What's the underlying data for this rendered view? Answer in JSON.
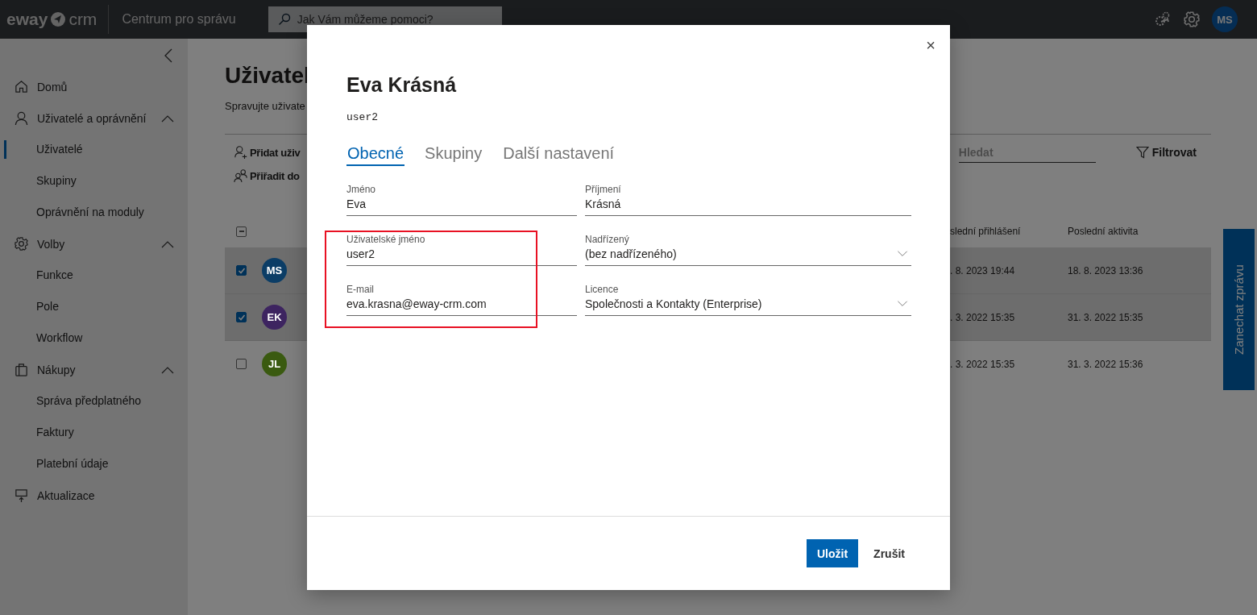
{
  "topbar": {
    "logo_left": "eway",
    "logo_right": "crm",
    "app_title": "Centrum pro správu",
    "search": {
      "placeholder": "Jak Vám můžeme pomoci?"
    },
    "avatar": "MS"
  },
  "sidebar": {
    "items": [
      {
        "label": "Domů",
        "selected": false
      },
      {
        "label": "Uživatelé a oprávnění",
        "selected": false,
        "expanded": true,
        "children": [
          {
            "label": "Uživatelé",
            "selected": true
          },
          {
            "label": "Skupiny",
            "selected": false
          },
          {
            "label": "Oprávnění na moduly",
            "selected": false
          }
        ]
      },
      {
        "label": "Volby",
        "selected": false,
        "expanded": true,
        "children": [
          {
            "label": "Funkce",
            "selected": false
          },
          {
            "label": "Pole",
            "selected": false
          },
          {
            "label": "Workflow",
            "selected": false
          }
        ]
      },
      {
        "label": "Nákupy",
        "selected": false,
        "expanded": true,
        "children": [
          {
            "label": "Správa předplatného",
            "selected": false
          },
          {
            "label": "Faktury",
            "selected": false
          },
          {
            "label": "Platební údaje",
            "selected": false
          }
        ]
      },
      {
        "label": "Aktualizace",
        "selected": false
      }
    ]
  },
  "page": {
    "title": "Uživatel",
    "subtitle": "Spravujte uživate",
    "actions": [
      "Přidat uživ",
      "Přiřadit do"
    ],
    "search": {
      "placeholder": "Hledat"
    },
    "filter": "Filtrovat",
    "table": {
      "header_partial": true,
      "columns": [
        "slední přihlášení",
        "Poslední aktivita"
      ],
      "rows": [
        {
          "checked": true,
          "initials": "MS",
          "color": "#0b3d66",
          "last_login": ". 8. 2023 19:44",
          "last_activity": "18. 8. 2023 13:36"
        },
        {
          "checked": true,
          "initials": "EK",
          "color": "#3d2460",
          "last_login": ". 3. 2022 15:35",
          "last_activity": "31. 3. 2022 15:35"
        },
        {
          "checked": false,
          "initials": "JL",
          "color": "#3a5a10",
          "last_login": ". 3. 2022 15:35",
          "last_activity": "31. 3. 2022 15:36"
        }
      ]
    }
  },
  "feedback": "Zanechat zprávu",
  "dialog": {
    "close": "×",
    "title": "Eva Krásná",
    "subtitle": "user2",
    "tabs": [
      {
        "label": "Obecné",
        "selected": true
      },
      {
        "label": "Skupiny",
        "selected": false
      },
      {
        "label": "Další nastavení",
        "selected": false
      }
    ],
    "fields": [
      {
        "kind": "text",
        "label": "Jméno",
        "value": "Eva"
      },
      {
        "kind": "text",
        "label": "Příjmení",
        "value": "Krásná"
      },
      {
        "kind": "text",
        "label": "Uživatelské jméno",
        "value": "user2"
      },
      {
        "kind": "select",
        "label": "Nadřízený",
        "value": "(bez nadřízeného)"
      },
      {
        "kind": "text",
        "label": "E-mail",
        "value": "eva.krasna@eway-crm.com"
      },
      {
        "kind": "select",
        "label": "Licence",
        "value": "Společnosti a Kontakty (Enterprise)"
      }
    ],
    "annotation_frame": true,
    "buttons": [
      {
        "label": "Uložit",
        "kind": "primary"
      },
      {
        "label": "Zrušit",
        "kind": "secondary"
      }
    ]
  }
}
